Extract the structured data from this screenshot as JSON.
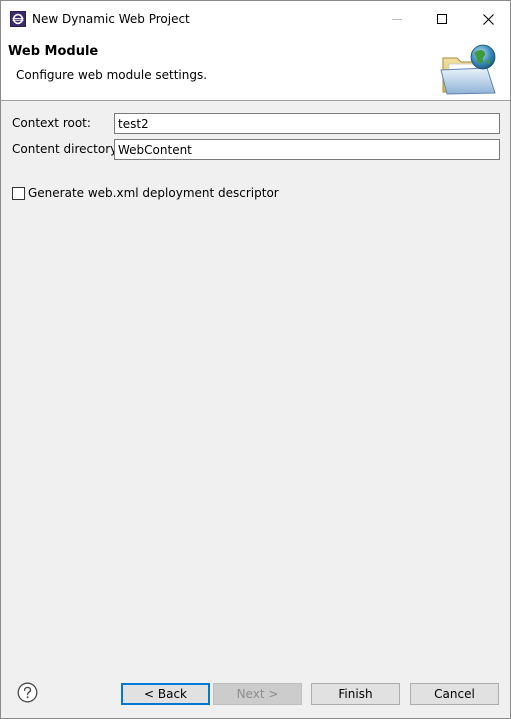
{
  "window": {
    "title": "New Dynamic Web Project"
  },
  "banner": {
    "title": "Web Module",
    "description": "Configure web module settings."
  },
  "form": {
    "context_root": {
      "label": "Context root:",
      "value": "test2"
    },
    "content_directory": {
      "label": "Content directory:",
      "value": "WebContent"
    },
    "generate_descriptor": {
      "label": "Generate web.xml deployment descriptor",
      "checked": false
    }
  },
  "buttons": {
    "back": "< Back",
    "next": "Next >",
    "finish": "Finish",
    "cancel": "Cancel"
  },
  "colors": {
    "focus_border": "#0078d7",
    "disabled_text": "#8d8d8d"
  },
  "icons": [
    "eclipse-app-icon",
    "minimize-icon",
    "maximize-icon",
    "close-icon",
    "folder-globe-icon",
    "help-icon"
  ]
}
